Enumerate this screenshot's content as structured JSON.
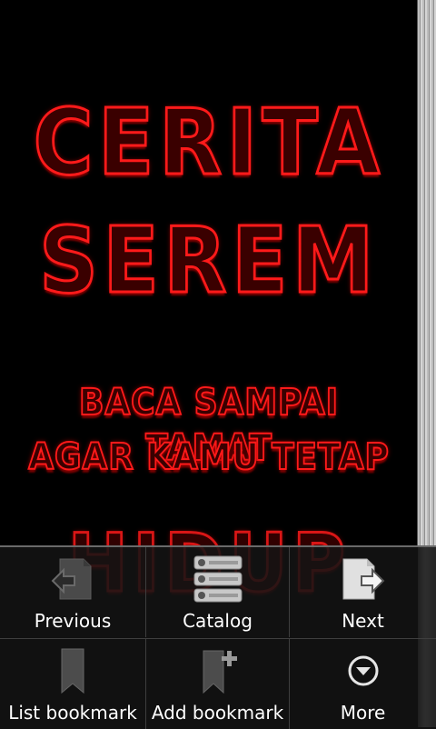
{
  "book": {
    "title_line1": "CERITA",
    "title_line2": "SEREM",
    "subtitle_line1": "BACA SAMPAI TAMAT",
    "subtitle_line2": "AGAR KAMU TETAP",
    "title_line3": "HIDUP"
  },
  "menu": {
    "previous_label": "Previous",
    "catalog_label": "Catalog",
    "next_label": "Next",
    "list_bookmark_label": "List bookmark",
    "add_bookmark_label": "Add bookmark",
    "more_label": "More"
  },
  "colors": {
    "title_red": "#ff1a1a",
    "menu_bg": "#141414"
  }
}
